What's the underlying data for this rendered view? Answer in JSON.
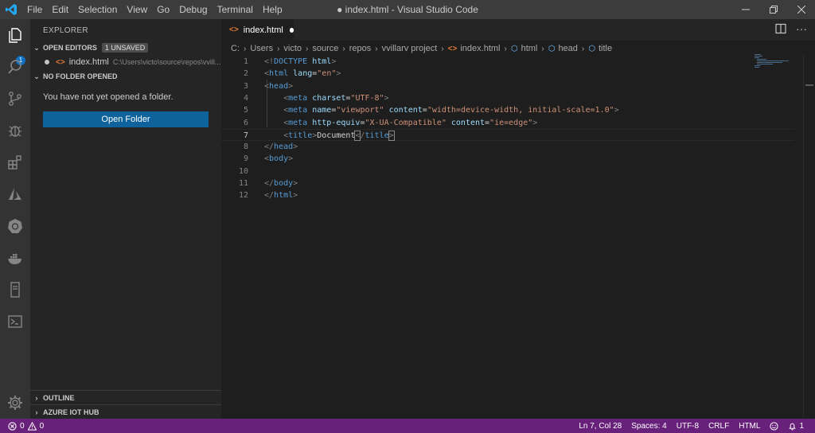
{
  "window": {
    "title": "● index.html - Visual Studio Code",
    "menu": [
      "File",
      "Edit",
      "Selection",
      "View",
      "Go",
      "Debug",
      "Terminal",
      "Help"
    ]
  },
  "activity_bar": {
    "icons": [
      "explorer-icon",
      "search-icon",
      "source-control-icon",
      "debug-icon",
      "extensions-icon",
      "azure-icon",
      "kubernetes-icon",
      "docker-icon",
      "remote-explorer-icon",
      "powershell-icon",
      "settings-gear-icon"
    ],
    "explorer_badge": "1"
  },
  "sidebar": {
    "title": "EXPLORER",
    "open_editors": {
      "header": "OPEN EDITORS",
      "unsaved_badge": "1 UNSAVED",
      "items": [
        {
          "name": "index.html",
          "path": "C:\\Users\\victo\\source\\repos\\vvill..."
        }
      ]
    },
    "no_folder": {
      "header": "NO FOLDER OPENED",
      "message": "You have not yet opened a folder.",
      "button": "Open Folder"
    },
    "outline": "OUTLINE",
    "azure_iot_hub": "AZURE IOT HUB"
  },
  "editor": {
    "tab": {
      "label": "index.html",
      "dirty": true
    },
    "breadcrumbs": [
      "C:",
      "Users",
      "victo",
      "source",
      "repos",
      "vvillarv project",
      "index.html",
      "html",
      "head",
      "title"
    ],
    "lines": [
      {
        "n": "1",
        "tokens": [
          [
            "br",
            "<!"
          ],
          [
            "tag",
            "DOCTYPE"
          ],
          [
            "tx",
            " "
          ],
          [
            "at",
            "html"
          ],
          [
            "br",
            ">"
          ]
        ]
      },
      {
        "n": "2",
        "tokens": [
          [
            "br",
            "<"
          ],
          [
            "tag",
            "html"
          ],
          [
            "tx",
            " "
          ],
          [
            "at",
            "lang"
          ],
          [
            "tx",
            "="
          ],
          [
            "str",
            "\"en\""
          ],
          [
            "br",
            ">"
          ]
        ]
      },
      {
        "n": "3",
        "tokens": [
          [
            "br",
            "<"
          ],
          [
            "tag",
            "head"
          ],
          [
            "br",
            ">"
          ]
        ]
      },
      {
        "n": "4",
        "tokens": [
          [
            "tx",
            "    "
          ],
          [
            "br",
            "<"
          ],
          [
            "tag",
            "meta"
          ],
          [
            "tx",
            " "
          ],
          [
            "at",
            "charset"
          ],
          [
            "tx",
            "="
          ],
          [
            "str",
            "\"UTF-8\""
          ],
          [
            "br",
            ">"
          ]
        ]
      },
      {
        "n": "5",
        "tokens": [
          [
            "tx",
            "    "
          ],
          [
            "br",
            "<"
          ],
          [
            "tag",
            "meta"
          ],
          [
            "tx",
            " "
          ],
          [
            "at",
            "name"
          ],
          [
            "tx",
            "="
          ],
          [
            "str",
            "\"viewport\""
          ],
          [
            "tx",
            " "
          ],
          [
            "at",
            "content"
          ],
          [
            "tx",
            "="
          ],
          [
            "str",
            "\"width=device-width, initial-scale=1.0\""
          ],
          [
            "br",
            ">"
          ]
        ]
      },
      {
        "n": "6",
        "tokens": [
          [
            "tx",
            "    "
          ],
          [
            "br",
            "<"
          ],
          [
            "tag",
            "meta"
          ],
          [
            "tx",
            " "
          ],
          [
            "at",
            "http-equiv"
          ],
          [
            "tx",
            "="
          ],
          [
            "str",
            "\"X-UA-Compatible\""
          ],
          [
            "tx",
            " "
          ],
          [
            "at",
            "content"
          ],
          [
            "tx",
            "="
          ],
          [
            "str",
            "\"ie=edge\""
          ],
          [
            "br",
            ">"
          ]
        ]
      },
      {
        "n": "7",
        "tokens": [
          [
            "tx",
            "    "
          ],
          [
            "br",
            "<"
          ],
          [
            "tag",
            "title"
          ],
          [
            "br",
            ">"
          ],
          [
            "tx",
            "Document"
          ],
          [
            "brbox",
            "<"
          ],
          [
            "br",
            "/"
          ],
          [
            "tag",
            "title"
          ],
          [
            "brbox",
            ">"
          ]
        ]
      },
      {
        "n": "8",
        "tokens": [
          [
            "br",
            "</"
          ],
          [
            "tag",
            "head"
          ],
          [
            "br",
            ">"
          ]
        ]
      },
      {
        "n": "9",
        "tokens": [
          [
            "br",
            "<"
          ],
          [
            "tag",
            "body"
          ],
          [
            "br",
            ">"
          ]
        ]
      },
      {
        "n": "10",
        "tokens": []
      },
      {
        "n": "11",
        "tokens": [
          [
            "br",
            "</"
          ],
          [
            "tag",
            "body"
          ],
          [
            "br",
            ">"
          ]
        ]
      },
      {
        "n": "12",
        "tokens": [
          [
            "br",
            "</"
          ],
          [
            "tag",
            "html"
          ],
          [
            "br",
            ">"
          ]
        ]
      }
    ],
    "current_line": "7"
  },
  "status_bar": {
    "errors": "0",
    "warnings": "0",
    "position": "Ln 7, Col 28",
    "spaces": "Spaces: 4",
    "encoding": "UTF-8",
    "eol": "CRLF",
    "language": "HTML",
    "notifications": "1"
  },
  "colors": {
    "statusbar": "#68217a",
    "accent": "#0e639c",
    "badge": "#0e70c0"
  }
}
